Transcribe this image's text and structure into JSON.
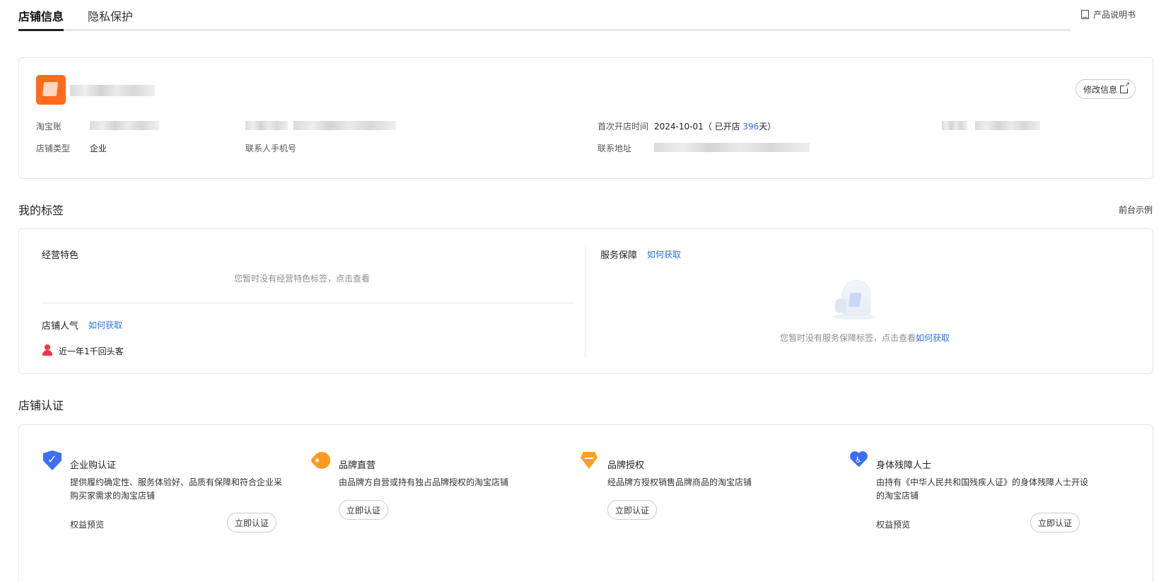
{
  "tabs": [
    {
      "label": "店铺信息",
      "active": true
    },
    {
      "label": "隐私保护",
      "active": false
    }
  ],
  "header": {
    "manual_label": "产品说明书"
  },
  "shop": {
    "edit_label": "修改信息",
    "fields": {
      "account_label": "淘宝账",
      "type_label": "店铺类型",
      "type_value": "企业",
      "phone_label": "联系人手机号",
      "open_label": "首次开店时间",
      "open_date": "2024-10-01",
      "open_prefix": "（ 已开店 ",
      "open_days": "396",
      "open_suffix": "天）",
      "address_label": "联系地址"
    }
  },
  "tags": {
    "title": "我的标签",
    "example_label": "前台示例",
    "feature_title": "经营特色",
    "feature_empty": "您暂时没有经营特色标签，点击查看",
    "popularity_title": "店铺人气",
    "how_to_get": "如何获取",
    "popularity_item": "近一年1千回头客",
    "service_title": "服务保障",
    "service_empty": "您暂时没有服务保障标签，点击查看"
  },
  "cert": {
    "title": "店铺认证",
    "items": [
      {
        "title": "企业购认证",
        "desc": "提供履约确定性、服务体验好、品质有保障和符合企业采购买家需求的淘宝店铺",
        "link": "权益预览",
        "button": "立即认证",
        "icon": "shield-check-icon",
        "color": "#3b6ff5"
      },
      {
        "title": "品牌直营",
        "desc": "由品牌方自营或持有独占品牌授权的淘宝店铺",
        "link": "",
        "button": "立即认证",
        "icon": "price-tag-icon",
        "color": "#ff9a1f"
      },
      {
        "title": "品牌授权",
        "desc": "经品牌方授权销售品牌商品的淘宝店铺",
        "link": "",
        "button": "立即认证",
        "icon": "diamond-icon",
        "color": "#ffa11f"
      },
      {
        "title": "身体残障人士",
        "desc": "由持有《中华人民共和国残疾人证》的身体残障人士开设的淘宝店铺",
        "link": "权益预览",
        "button": "立即认证",
        "icon": "accessibility-heart-icon",
        "color": "#3b6ff5"
      }
    ]
  }
}
